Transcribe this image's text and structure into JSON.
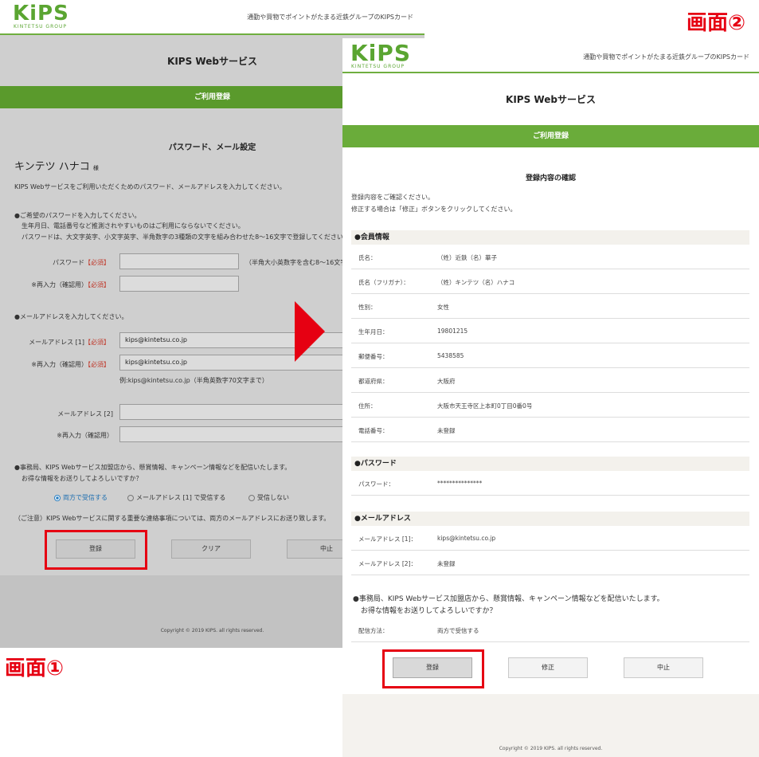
{
  "labels": {
    "screen1": "画面①",
    "screen2": "画面②"
  },
  "brand": {
    "logo": "KiPS",
    "group": "KINTETSU GROUP",
    "tagline": "通勤や買物でポイントがたまる近鉄グループのKIPSカード"
  },
  "service_title": "KIPS Webサービス",
  "registration_bar": "ご利用登録",
  "screen1": {
    "section_title": "パスワード、メール設定",
    "user_name": "キンテツ ハナコ",
    "honorific": "様",
    "intro": "KIPS Webサービスをご利用いただくためのパスワード、メールアドレスを入力してください。",
    "password_instructions": [
      "●ご希望のパスワードを入力してください。",
      "生年月日、電話番号など推測されやすいものはご利用にならないでください。",
      "パスワードは、大文字英字、小文字英字、半角数字の3種類の文字を組み合わせた8〜16文字で登録してください"
    ],
    "password_label": "パスワード",
    "required": "【必須】",
    "password_hint": "（半角大小英数字を含む8〜16文字",
    "reenter_label": "※再入力（確認用）",
    "email_instruction": "●メールアドレスを入力してください。",
    "email1_label": "メールアドレス [1]",
    "email1_value": "kips@kintetsu.co.jp",
    "email1_confirm_value": "kips@kintetsu.co.jp",
    "email_example": "例:kips@kintetsu.co.jp（半角英数字70文字まで）",
    "email2_label": "メールアドレス [2]",
    "email2_confirm_label": "※再入力（確認用）",
    "newsletter_lines": [
      "●事務局、KIPS Webサービス加盟店から、懸賞情報、キャンペーン情報などを配信いたします。",
      "お得な情報をお送りしてよろしいですか？"
    ],
    "radio_options": [
      "両方で受信する",
      "メールアドレス [1] で受信する",
      "受信しない"
    ],
    "caution": "（ご注意）KIPS Webサービスに関する重要な連絡事項については、両方のメールアドレスにお送り致します。",
    "buttons": {
      "register": "登録",
      "clear": "クリア",
      "cancel": "中止"
    },
    "copyright": "Copyright © 2019 KIPS. all rights reserved."
  },
  "screen2": {
    "title": "登録内容の確認",
    "intro_lines": [
      "登録内容をご確認ください。",
      "修正する場合は「修正」ボタンをクリックしてください。"
    ],
    "member_header": "●会員情報",
    "member_rows": [
      {
        "key": "氏名：",
        "value": "（姓）近鉄（名）華子"
      },
      {
        "key": "氏名（フリガナ）：",
        "value": "（姓）キンテツ（名）ハナコ"
      },
      {
        "key": "性別：",
        "value": "女性"
      },
      {
        "key": "生年月日：",
        "value": "19801215"
      },
      {
        "key": "郵便番号：",
        "value": "5438585"
      },
      {
        "key": "都道府県：",
        "value": "大阪府"
      },
      {
        "key": "住所：",
        "value": "大阪市天王寺区上本町0丁目0番0号"
      },
      {
        "key": "電話番号：",
        "value": "未登録"
      }
    ],
    "password_header": "●パスワード",
    "password_row": {
      "key": "パスワード：",
      "value": "***************"
    },
    "email_header": "●メールアドレス",
    "email_rows": [
      {
        "key": "メールアドレス [1]：",
        "value": "kips@kintetsu.co.jp"
      },
      {
        "key": "メールアドレス [2]：",
        "value": "未登録"
      }
    ],
    "newsletter_lines": [
      "●事務局、KIPS Webサービス加盟店から、懸賞情報、キャンペーン情報などを配信いたします。",
      "お得な情報をお送りしてよろしいですか？"
    ],
    "delivery_row": {
      "key": "配信方法：",
      "value": "両方で受信する"
    },
    "buttons": {
      "register": "登録",
      "edit": "修正",
      "cancel": "中止"
    },
    "copyright": "Copyright © 2019 KIPS. all rights reserved."
  },
  "colors": {
    "green": "#6aac3a",
    "highlight_red": "#e60012"
  }
}
